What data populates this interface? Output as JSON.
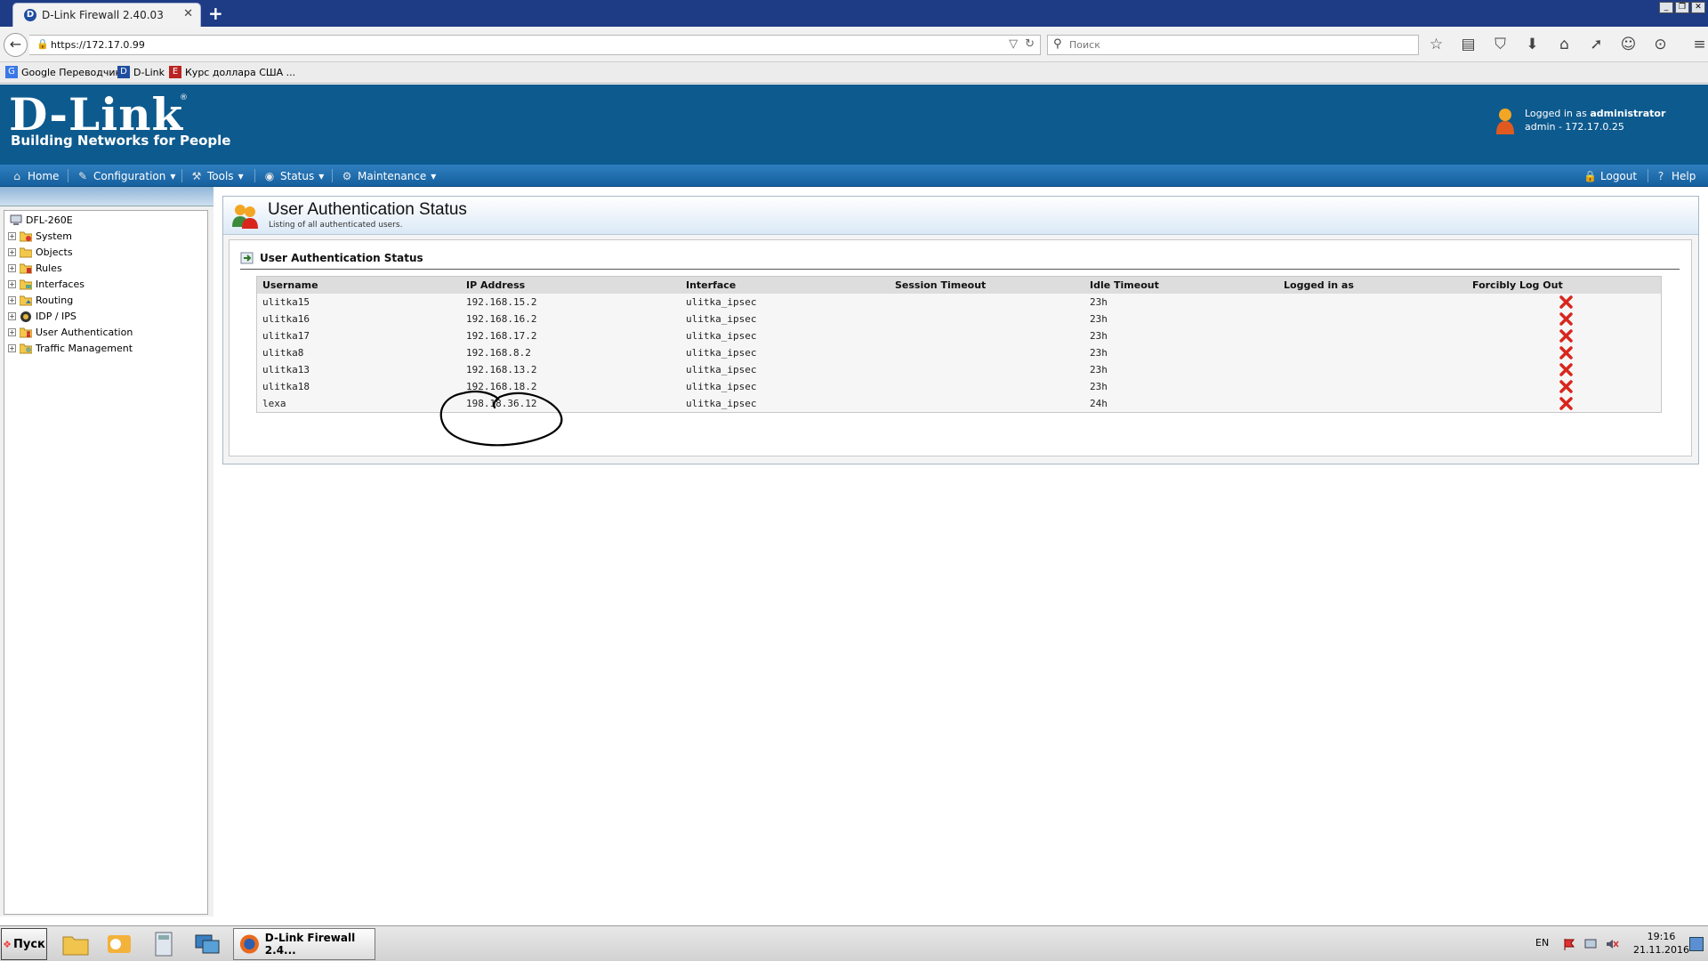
{
  "browser": {
    "tab_title": "D-Link Firewall 2.40.03",
    "url": "https://172.17.0.99",
    "search_placeholder": "Поиск",
    "bookmarks": [
      {
        "label": "Google Переводчик"
      },
      {
        "label": "D-Link"
      },
      {
        "label": "Курс доллара США ..."
      }
    ]
  },
  "header": {
    "logo_text": "D-Link",
    "logo_tagline": "Building Networks for People",
    "logged_in_prefix": "Logged in as",
    "logged_in_user": "administrator",
    "logged_in_detail": "admin - 172.17.0.25"
  },
  "menu": {
    "home": "Home",
    "configuration": "Configuration",
    "tools": "Tools",
    "status": "Status",
    "maintenance": "Maintenance",
    "logout": "Logout",
    "help": "Help"
  },
  "tree": {
    "root": "DFL-260E",
    "items": [
      {
        "label": "System"
      },
      {
        "label": "Objects"
      },
      {
        "label": "Rules"
      },
      {
        "label": "Interfaces"
      },
      {
        "label": "Routing"
      },
      {
        "label": "IDP / IPS"
      },
      {
        "label": "User Authentication"
      },
      {
        "label": "Traffic Management"
      }
    ]
  },
  "page": {
    "title": "User Authentication Status",
    "subtitle": "Listing of all authenticated users.",
    "section_title": "User Authentication Status"
  },
  "table": {
    "headers": [
      "Username",
      "IP Address",
      "Interface",
      "Session Timeout",
      "Idle Timeout",
      "Logged in as",
      "Forcibly Log Out"
    ],
    "rows": [
      {
        "username": "ulitka15",
        "ip": "192.168.15.2",
        "iface": "ulitka_ipsec",
        "session": "",
        "idle": "23h",
        "logged_as": ""
      },
      {
        "username": "ulitka16",
        "ip": "192.168.16.2",
        "iface": "ulitka_ipsec",
        "session": "",
        "idle": "23h",
        "logged_as": ""
      },
      {
        "username": "ulitka17",
        "ip": "192.168.17.2",
        "iface": "ulitka_ipsec",
        "session": "",
        "idle": "23h",
        "logged_as": ""
      },
      {
        "username": "ulitka8",
        "ip": "192.168.8.2",
        "iface": "ulitka_ipsec",
        "session": "",
        "idle": "23h",
        "logged_as": ""
      },
      {
        "username": "ulitka13",
        "ip": "192.168.13.2",
        "iface": "ulitka_ipsec",
        "session": "",
        "idle": "23h",
        "logged_as": ""
      },
      {
        "username": "ulitka18",
        "ip": "192.168.18.2",
        "iface": "ulitka_ipsec",
        "session": "",
        "idle": "23h",
        "logged_as": ""
      },
      {
        "username": "lexa",
        "ip": "198.18.36.12",
        "iface": "ulitka_ipsec",
        "session": "",
        "idle": "24h",
        "logged_as": ""
      }
    ]
  },
  "taskbar": {
    "start_label": "Пуск",
    "active_task": "D-Link Firewall 2.4...",
    "language": "EN",
    "time": "19:16",
    "date": "21.11.2016"
  },
  "colors": {
    "header_blue": "#0d5a8e",
    "menu_blue": "#155f9e",
    "logout_red": "#d8261c"
  }
}
